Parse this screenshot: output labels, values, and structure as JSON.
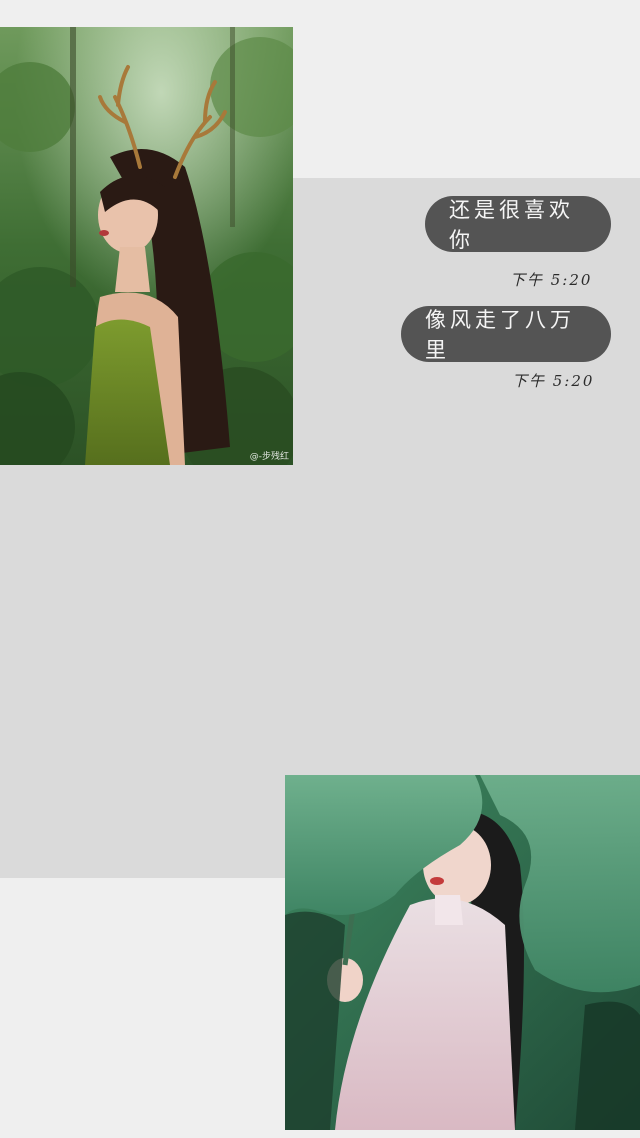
{
  "messages": [
    {
      "text": "还是很喜欢你",
      "time": "下午 5:20"
    },
    {
      "text": "像风走了八万里",
      "time": "下午 5:20"
    }
  ],
  "photo_watermark": "@-步残红",
  "colors": {
    "page_background": "#efefef",
    "band_background": "#dadada",
    "bubble_background": "#545454",
    "bubble_text": "#f5f5f5"
  },
  "images": [
    {
      "name": "girl-with-antlers-in-forest"
    },
    {
      "name": "girl-under-lotus-leaf"
    }
  ]
}
